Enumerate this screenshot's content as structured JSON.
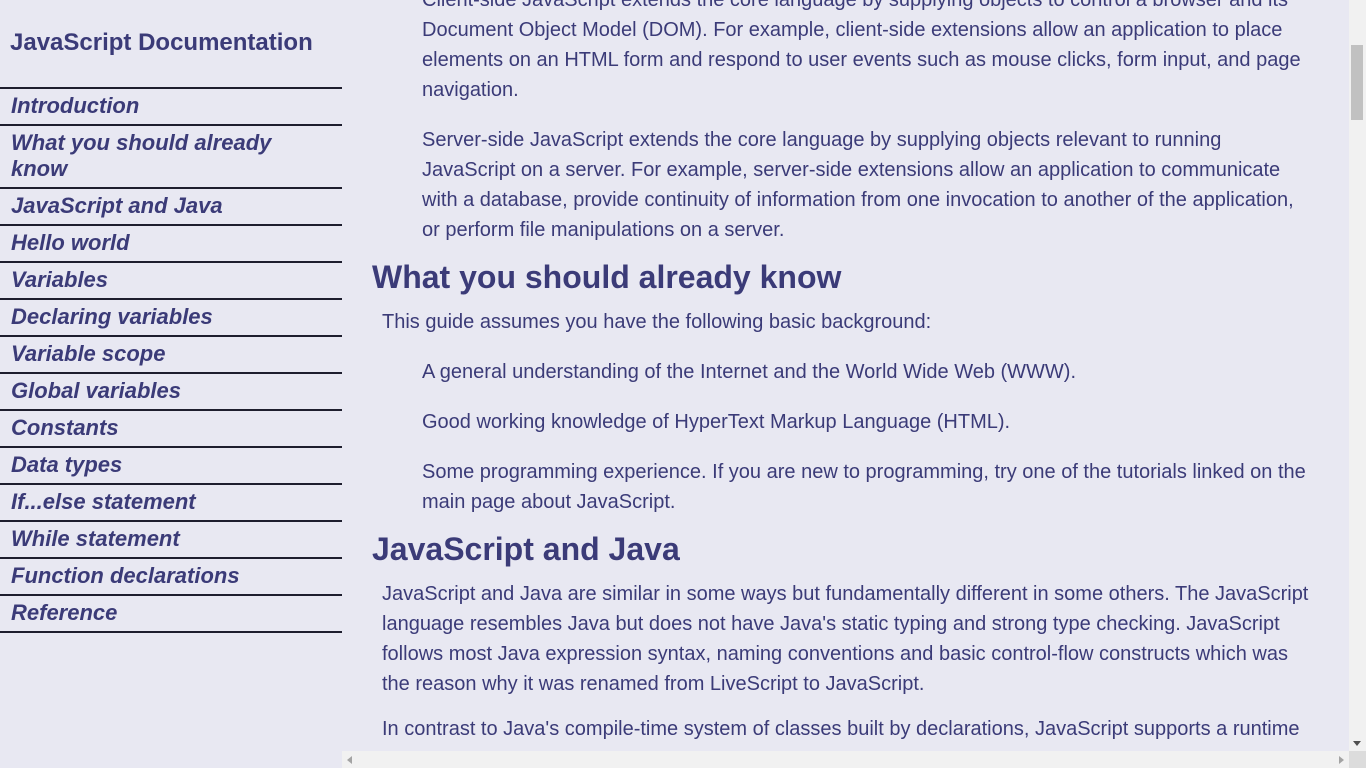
{
  "nav": {
    "title": "JavaScript Documentation",
    "links": [
      "Introduction",
      "What you should already know",
      "JavaScript and Java",
      "Hello world",
      "Variables",
      "Declaring variables",
      "Variable scope",
      "Global variables",
      "Constants",
      "Data types",
      "If...else statement",
      "While statement",
      "Function declarations",
      "Reference"
    ]
  },
  "main": {
    "intro_client": "Client-side JavaScript extends the core language by supplying objects to control a browser and its Document Object Model (DOM). For example, client-side extensions allow an application to place elements on an HTML form and respond to user events such as mouse clicks, form input, and page navigation.",
    "intro_server": "Server-side JavaScript extends the core language by supplying objects relevant to running JavaScript on a server. For example, server-side extensions allow an application to communicate with a database, provide continuity of information from one invocation to another of the application, or perform file manipulations on a server.",
    "know_heading": "What you should already know",
    "know_intro": "This guide assumes you have the following basic background:",
    "know_items": [
      "A general understanding of the Internet and the World Wide Web (WWW).",
      "Good working knowledge of HyperText Markup Language (HTML).",
      "Some programming experience. If you are new to programming, try one of the tutorials linked on the main page about JavaScript."
    ],
    "java_heading": "JavaScript and Java",
    "java_p1": "JavaScript and Java are similar in some ways but fundamentally different in some others. The JavaScript language resembles Java but does not have Java's static typing and strong type checking. JavaScript follows most Java expression syntax, naming conventions and basic control-flow constructs which was the reason why it was renamed from LiveScript to JavaScript.",
    "java_p2": "In contrast to Java's compile-time system of classes built by declarations, JavaScript supports a runtime"
  }
}
